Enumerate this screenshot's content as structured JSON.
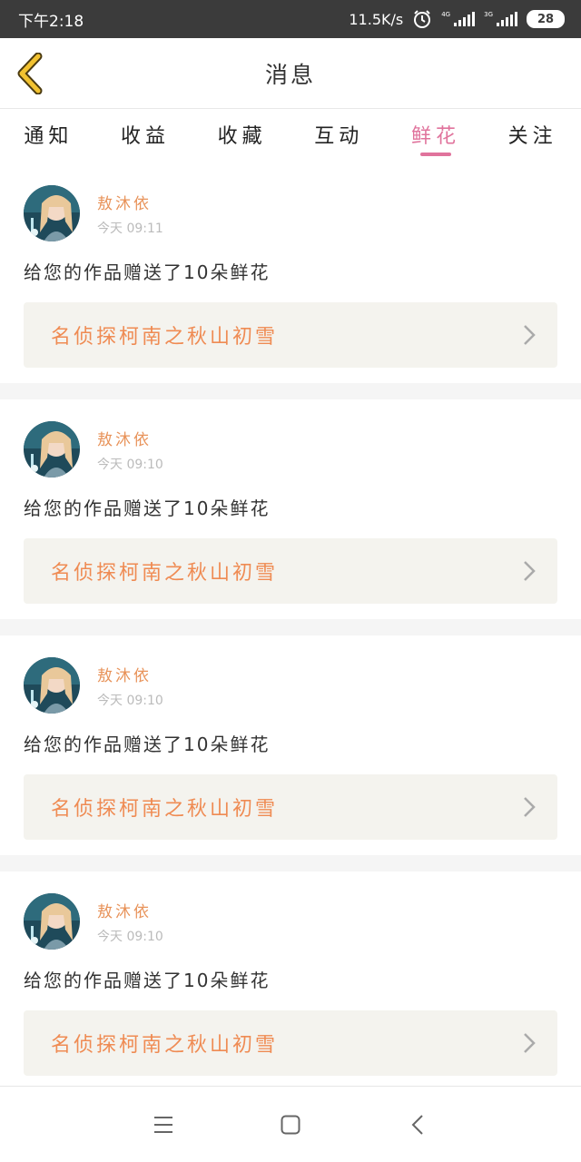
{
  "status_bar": {
    "time": "下午2:18",
    "speed": "11.5K/s",
    "net1": "4G",
    "net2": "3G",
    "battery": "28"
  },
  "header": {
    "title": "消息"
  },
  "tabs": [
    {
      "label": "通知"
    },
    {
      "label": "收益"
    },
    {
      "label": "收藏"
    },
    {
      "label": "互动"
    },
    {
      "label": "鲜花",
      "active": true
    },
    {
      "label": "关注"
    }
  ],
  "messages": [
    {
      "sender": "敖沐依",
      "time": "今天 09:11",
      "text": "给您的作品赠送了10朵鲜花",
      "work": "名侦探柯南之秋山初雪"
    },
    {
      "sender": "敖沐依",
      "time": "今天 09:10",
      "text": "给您的作品赠送了10朵鲜花",
      "work": "名侦探柯南之秋山初雪"
    },
    {
      "sender": "敖沐依",
      "time": "今天 09:10",
      "text": "给您的作品赠送了10朵鲜花",
      "work": "名侦探柯南之秋山初雪"
    },
    {
      "sender": "敖沐依",
      "time": "今天 09:10",
      "text": "给您的作品赠送了10朵鲜花",
      "work": "名侦探柯南之秋山初雪"
    }
  ],
  "colors": {
    "accent": "#e0739c",
    "sender": "#e8935a",
    "work_title": "#ef8b53",
    "back_arrow": "#f2c230"
  }
}
